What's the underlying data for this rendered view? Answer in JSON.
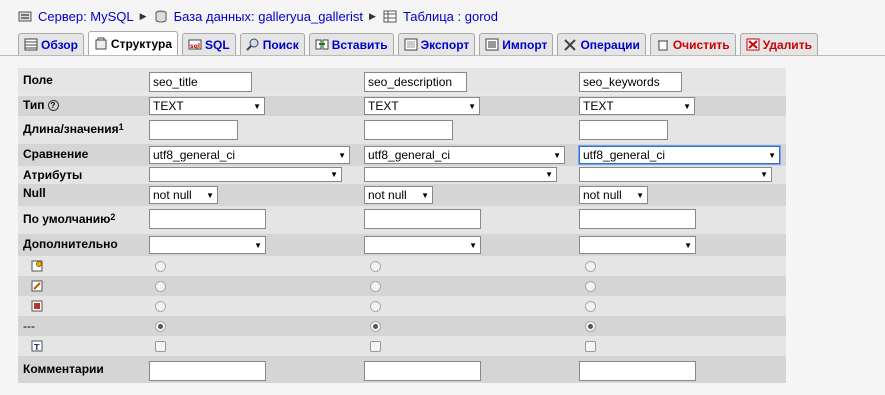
{
  "breadcrumb": {
    "server": "Сервер: MySQL",
    "database": "База данных: galleryua_gallerist",
    "table": "Таблица : gorod"
  },
  "tabs": [
    {
      "label": "Обзор",
      "icon": "browse-icon"
    },
    {
      "label": "Структура",
      "icon": "structure-icon"
    },
    {
      "label": "SQL",
      "icon": "sql-icon"
    },
    {
      "label": "Поиск",
      "icon": "search-icon"
    },
    {
      "label": "Вставить",
      "icon": "insert-icon"
    },
    {
      "label": "Экспорт",
      "icon": "export-icon"
    },
    {
      "label": "Импорт",
      "icon": "import-icon"
    },
    {
      "label": "Операции",
      "icon": "operations-icon"
    },
    {
      "label": "Очистить",
      "icon": "empty-icon"
    },
    {
      "label": "Удалить",
      "icon": "drop-icon"
    }
  ],
  "active_tab": "Структура",
  "form": {
    "labels": {
      "field": "Поле",
      "type": "Тип",
      "length": "Длина/значения",
      "length_note": "1",
      "collation": "Сравнение",
      "attributes": "Атрибуты",
      "null": "Null",
      "default": "По умолчанию",
      "default_note": "2",
      "extra": "Дополнительно",
      "index_none": "---",
      "comments": "Комментарии"
    },
    "help_glyph": "?",
    "columns": [
      {
        "field": "seo_title",
        "type": "TEXT",
        "length": "",
        "collation": "utf8_general_ci",
        "attributes": "",
        "null": "not null",
        "default": "",
        "extra": "",
        "comment": ""
      },
      {
        "field": "seo_description",
        "type": "TEXT",
        "length": "",
        "collation": "utf8_general_ci",
        "attributes": "",
        "null": "not null",
        "default": "",
        "extra": "",
        "comment": ""
      },
      {
        "field": "seo_keywords",
        "type": "TEXT",
        "length": "",
        "collation": "utf8_general_ci",
        "attributes": "",
        "null": "not null",
        "default": "",
        "extra": "",
        "comment": ""
      }
    ],
    "index_options": [
      "primary-key-icon",
      "index-icon",
      "unique-icon",
      "none",
      "fulltext-icon"
    ],
    "selected_index": "none",
    "focused_collation_column": 2
  },
  "colors": {
    "link": "#0000cc",
    "danger": "#cc0000",
    "row_odd": "#e5e5e5",
    "row_even": "#d5d5d5"
  }
}
